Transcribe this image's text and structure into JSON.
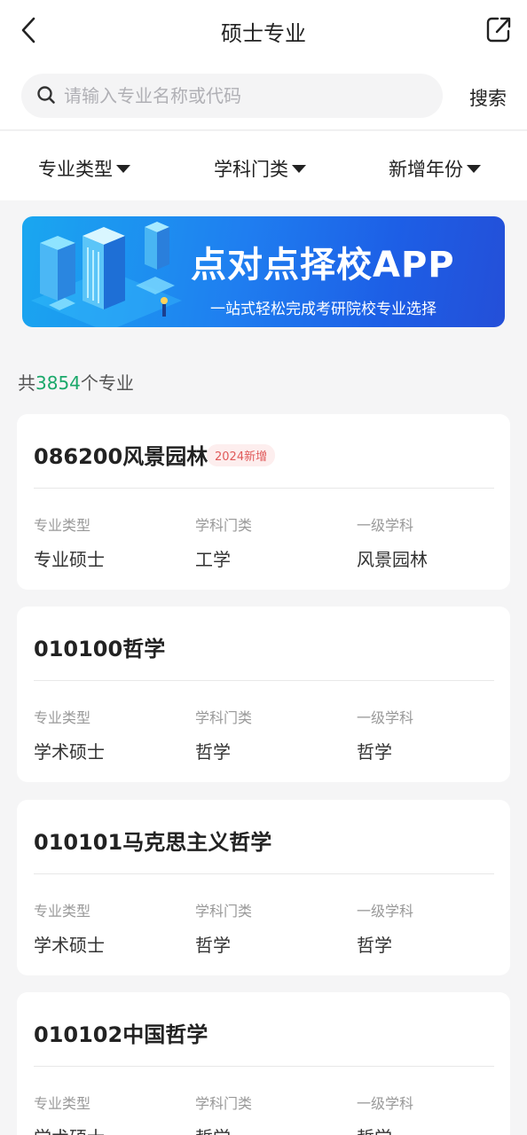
{
  "header": {
    "title": "硕士专业"
  },
  "search": {
    "placeholder": "请输入专业名称或代码",
    "button_label": "搜索"
  },
  "filters": [
    {
      "label": "专业类型"
    },
    {
      "label": "学科门类"
    },
    {
      "label": "新增年份"
    }
  ],
  "banner": {
    "title": "点对点择校APP",
    "subtitle": "一站式轻松完成考研院校专业选择"
  },
  "summary": {
    "prefix": "共",
    "count": "3854",
    "suffix": "个专业"
  },
  "field_labels": {
    "type": "专业类型",
    "category": "学科门类",
    "discipline": "一级学科"
  },
  "majors": [
    {
      "title": "086200风景园林",
      "badge": "2024新增",
      "type": "专业硕士",
      "category": "工学",
      "discipline": "风景园林"
    },
    {
      "title": "010100哲学",
      "badge": "",
      "type": "学术硕士",
      "category": "哲学",
      "discipline": "哲学"
    },
    {
      "title": "010101马克思主义哲学",
      "badge": "",
      "type": "学术硕士",
      "category": "哲学",
      "discipline": "哲学"
    },
    {
      "title": "010102中国哲学",
      "badge": "",
      "type": "学术硕士",
      "category": "哲学",
      "discipline": "哲学"
    }
  ],
  "colors": {
    "accent_green": "#1aa86a",
    "badge_red": "#e05a5a",
    "banner_blue": "#1f7ef0"
  }
}
